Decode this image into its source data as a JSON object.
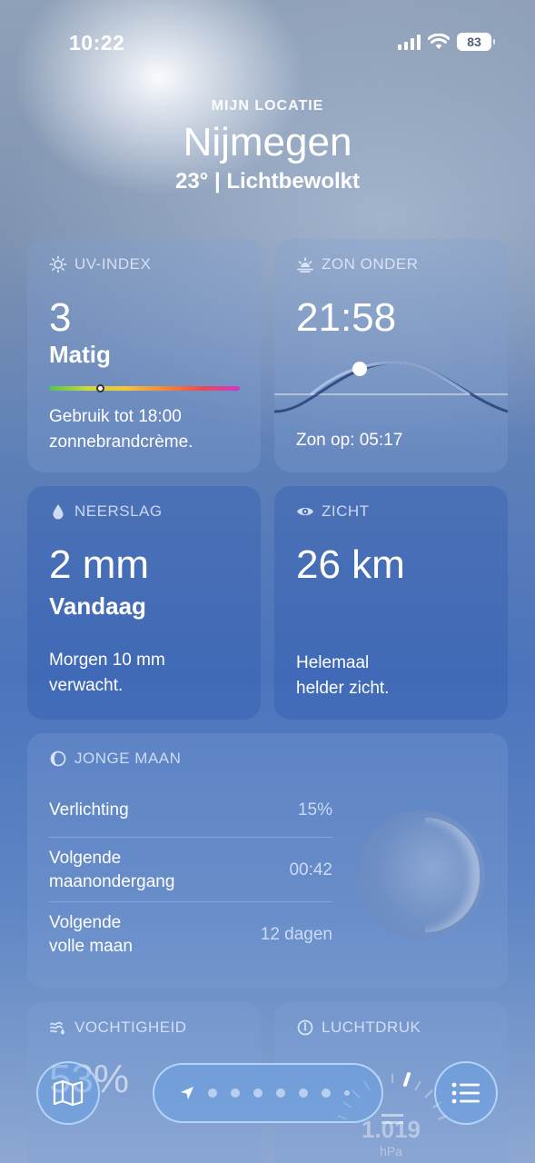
{
  "status": {
    "time": "10:22",
    "battery": "83"
  },
  "header": {
    "location_label": "MIJN LOCATIE",
    "city": "Nijmegen",
    "summary": "23°  |  Lichtbewolkt"
  },
  "uv": {
    "title": "UV-INDEX",
    "value": "3",
    "level": "Matig",
    "level_fraction": 0.27,
    "desc_line1": "Gebruik tot 18:00",
    "desc_line2": "zonnebrandcrème."
  },
  "sunset": {
    "title": "ZON ONDER",
    "time": "21:58",
    "sunrise": "Zon op: 05:17"
  },
  "precip": {
    "title": "NEERSLAG",
    "value": "2 mm",
    "period": "Vandaag",
    "desc_line1": "Morgen 10 mm",
    "desc_line2": "verwacht."
  },
  "visibility": {
    "title": "ZICHT",
    "value": "26 km",
    "desc_line1": "Helemaal",
    "desc_line2": "helder zicht."
  },
  "moon": {
    "title": "JONGE MAAN",
    "rows": [
      {
        "label": "Verlichting",
        "value": "15%"
      },
      {
        "label_line1": "Volgende",
        "label_line2": "maanondergang",
        "value": "00:42"
      },
      {
        "label_line1": "Volgende",
        "label_line2": "volle maan",
        "value": "12 dagen"
      }
    ]
  },
  "humidity": {
    "title": "VOCHTIGHEID",
    "value": "53%"
  },
  "pressure": {
    "title": "LUCHTDRUK",
    "value": "1.019",
    "unit": "hPa"
  },
  "icons": {
    "map": "map-icon",
    "list": "list-icon",
    "location": "location-arrow-icon"
  }
}
